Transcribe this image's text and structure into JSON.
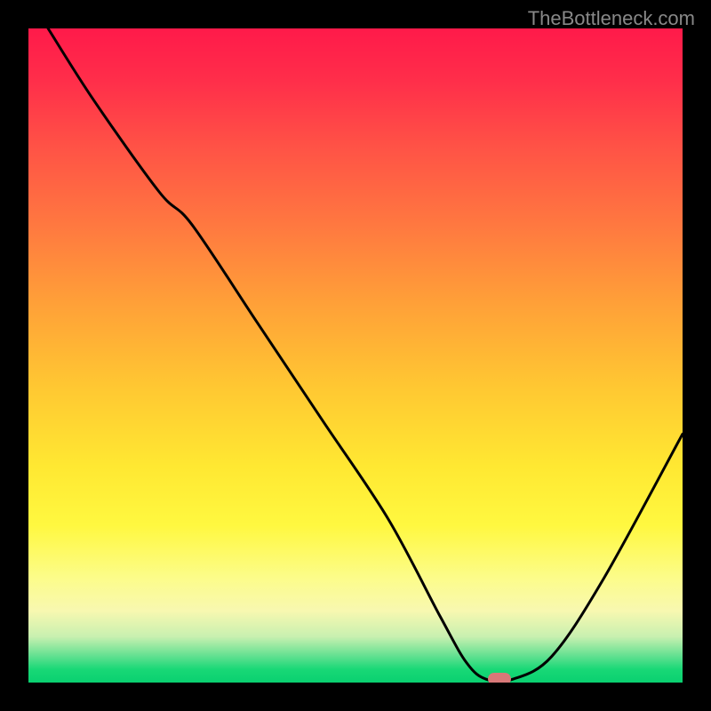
{
  "watermark": "TheBottleneck.com",
  "chart_data": {
    "type": "line",
    "title": "",
    "xlabel": "",
    "ylabel": "",
    "xlim": [
      0,
      100
    ],
    "ylim": [
      0,
      100
    ],
    "x": [
      3,
      10,
      20,
      25,
      35,
      45,
      55,
      63,
      67,
      70,
      74,
      80,
      88,
      100
    ],
    "values": [
      100,
      89,
      75,
      70,
      55,
      40,
      25,
      10,
      3,
      0.5,
      0.5,
      4,
      16,
      38
    ],
    "marker": {
      "x": 72,
      "y": 0.5
    },
    "background_gradient": {
      "top": "#ff1a4a",
      "mid": "#ffd030",
      "bottom": "#0ad070"
    }
  }
}
